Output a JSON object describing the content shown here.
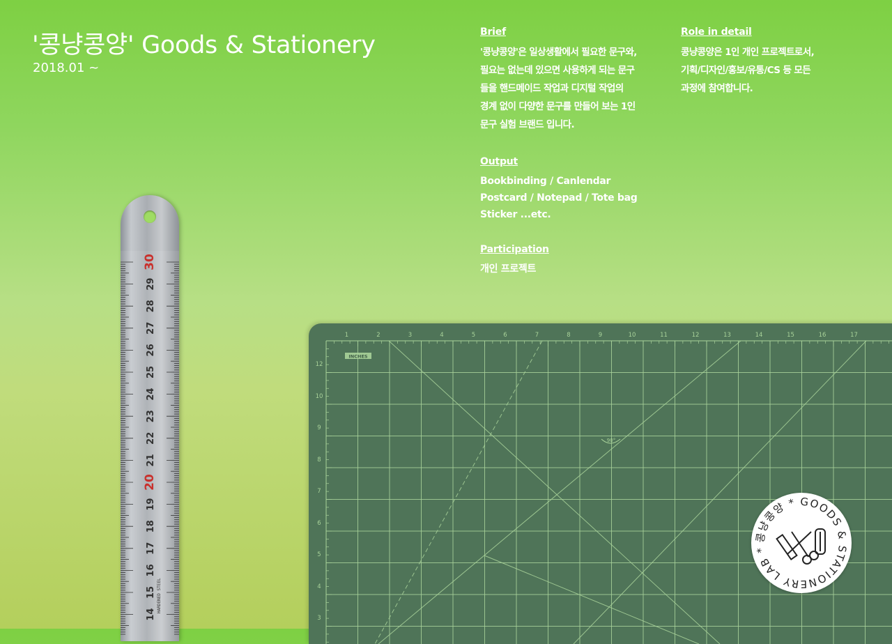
{
  "header": {
    "title": "'콩냥콩양' Goods & Stationery",
    "date": "2018.01 ~"
  },
  "brief": {
    "heading": "Brief",
    "text": "'콩냥콩양'은 일상생활에서 필요한 문구와,\n필요는 없는데 있으면 사용하게 되는 문구\n들을 핸드메이드 작업과 디지털 작업의\n경계 없이 다양한 문구를 만들어 보는 1인\n문구 실험 브랜드 입니다."
  },
  "role": {
    "heading": "Role in detail",
    "text": "콩냥콩양은 1인 개인 프로젝트로서,\n기획/디자인/홍보/유통/CS 등 모든\n과정에 참여합니다."
  },
  "output": {
    "heading": "Output",
    "items": [
      "Bookbinding / Canlendar",
      "Postcard / Notepad / Tote bag",
      "Sticker ...etc."
    ]
  },
  "participation": {
    "heading": "Participation",
    "text": "개인 프로젝트"
  },
  "ruler": {
    "numbers": [
      "30",
      "29",
      "28",
      "27",
      "26",
      "25",
      "24",
      "23",
      "22",
      "21",
      "20",
      "19",
      "18",
      "17",
      "16",
      "15",
      "14"
    ],
    "brand_text": "HARDENED STEEL"
  },
  "mat": {
    "unit_label": "INCHES",
    "top_numbers": [
      "1",
      "2",
      "3",
      "4",
      "5",
      "6",
      "7",
      "8",
      "9",
      "10",
      "11",
      "12",
      "13",
      "14",
      "15",
      "16",
      "17"
    ],
    "side_numbers": [
      "12",
      "10",
      "9",
      "8",
      "7",
      "6",
      "5",
      "4",
      "3"
    ],
    "angle_label": "90°"
  },
  "badge": {
    "ring_text": "콩냥콩양 * GOODS & STATIONERY LAB *"
  },
  "colors": {
    "bg_top": "#7ed043",
    "bg_bottom": "#b4cf5c",
    "mat": "#4f7458",
    "mat_lines": "#a9d39a",
    "ruler_red": "#c9302c"
  }
}
